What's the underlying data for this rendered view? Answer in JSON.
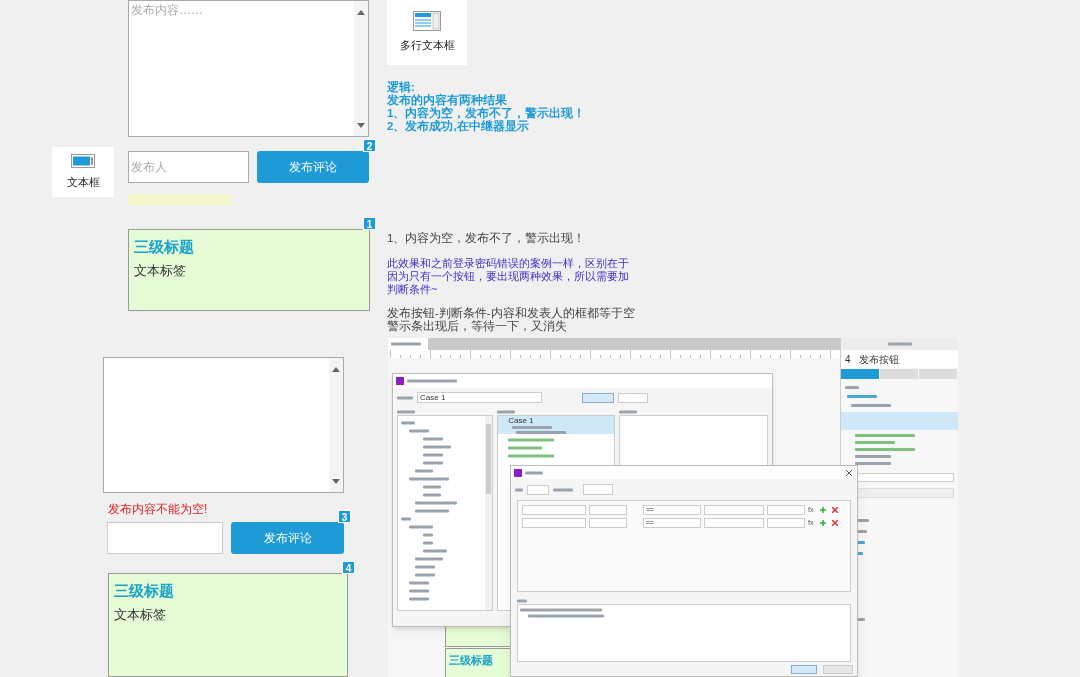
{
  "library_widgets": [
    {
      "kind": "multiline",
      "label": "多行文本框"
    },
    {
      "kind": "textbox",
      "label": "文本框"
    }
  ],
  "top_prototype": {
    "content_field": {
      "placeholder": "发布内容……"
    },
    "author_field": {
      "placeholder": "发布人"
    },
    "submit_button": {
      "label": "发布评论",
      "badge": "2"
    },
    "relay_panel": {
      "badge": "1",
      "heading": "三级标题",
      "label": "文本标签"
    }
  },
  "logic_note": [
    "逻辑:",
    "发布的内容有两种结果",
    "1、内容为空，发布不了，警示出现！",
    "2、发布成功,在中继器显示"
  ],
  "explanation": {
    "heading": "1、内容为空，发布不了，警示出现！",
    "highlight": "此效果和之前登录密码错误的案例一样，区别在于因为只有一个按钮，要出现两种效果，所以需要加判断条件~",
    "steps": [
      "发布按钮-判断条件-内容和发表人的框都等于空",
      "警示条出现后，等待一下，又消失"
    ]
  },
  "bottom_prototype": {
    "error_message": "发布内容不能为空!",
    "submit_button": {
      "label": "发布评论",
      "badge": "3"
    },
    "relay_panel": {
      "badge": "4",
      "heading": "三级标题",
      "label": "文本标签"
    }
  },
  "embedded_screenshot": {
    "case_name": "Case 1",
    "case_item": "Case 1",
    "inspector": {
      "number": "4",
      "title": "发布按钮",
      "tabs": [
        {
          "selected": true
        },
        {
          "selected": false
        },
        {
          "selected": false
        }
      ]
    },
    "conditions": [
      {
        "operator": "==",
        "fx": "fx"
      },
      {
        "operator": "==",
        "fx": "fx"
      }
    ],
    "background_heading": "三级标题"
  }
}
